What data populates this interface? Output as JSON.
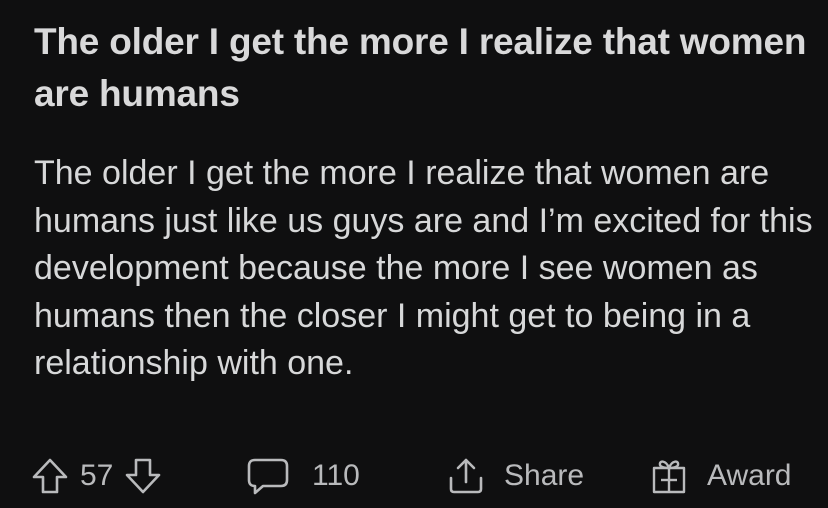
{
  "post": {
    "title": "The older I get the more I realize that women are humans",
    "body": "The older I get the more I realize that women are humans just like us guys are and I’m excited for this development because the more I see women as humans then the closer I might get to being in a relationship with one."
  },
  "actions": {
    "vote_count": "57",
    "comment_count": "110",
    "share_label": "Share",
    "award_label": "Award"
  },
  "icons": {
    "upvote": "arrow-up-icon",
    "downvote": "arrow-down-icon",
    "comment": "speech-bubble-icon",
    "share": "share-upload-icon",
    "award": "gift-box-icon"
  },
  "colors": {
    "background": "#0f0f10",
    "text": "#d7d8d9",
    "muted": "#b9babc"
  }
}
